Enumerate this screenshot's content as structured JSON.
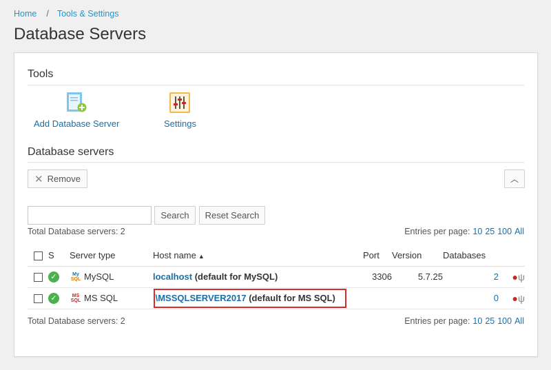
{
  "breadcrumb": {
    "home": "Home",
    "separator": "/",
    "tools": "Tools & Settings"
  },
  "page_title": "Database Servers",
  "tools_section": {
    "title": "Tools",
    "add_server": {
      "label": "Add Database Server",
      "icon": "add-database-server-icon"
    },
    "settings": {
      "label": "Settings",
      "icon": "settings-sliders-icon"
    }
  },
  "servers_section": {
    "title": "Database servers",
    "remove_label": "Remove",
    "collapse_glyph": "︿",
    "search": {
      "value": "",
      "placeholder": "",
      "search_label": "Search",
      "reset_label": "Reset Search"
    },
    "total_label": "Total Database servers: 2",
    "entries_label": "Entries per page:",
    "entries_options": [
      "10",
      "25",
      "100",
      "All"
    ],
    "columns": {
      "s": "S",
      "server_type": "Server type",
      "host_name": "Host name",
      "port": "Port",
      "version": "Version",
      "databases": "Databases"
    },
    "rows": [
      {
        "type_line1": "My",
        "type_line2": "SQL",
        "server_type": "MySQL",
        "host": "localhost",
        "host_note": "(default for MySQL)",
        "port": "3306",
        "version": "5.7.25",
        "databases": "2"
      },
      {
        "type_line1": "MS",
        "type_line2": "SQL",
        "server_type": "MS SQL",
        "host": ".\\MSSQLSERVER2017",
        "host_note": "(default for MS SQL)",
        "port": "",
        "version": "",
        "databases": "0"
      }
    ]
  },
  "colors": {
    "link": "#1a6fa8",
    "breadcrumb": "#1a9ad0",
    "status_ok": "#4cb04c",
    "highlight": "#d92a2a"
  }
}
